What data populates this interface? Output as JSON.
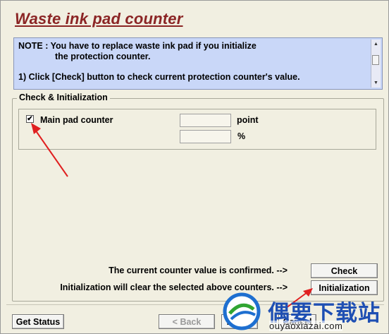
{
  "window": {
    "title": "Waste ink pad counter"
  },
  "note": {
    "line1": "NOTE : You have to replace waste ink pad if you initialize",
    "line2": "the protection counter.",
    "line3": "1) Click [Check] button to check current protection counter's value."
  },
  "group": {
    "label": "Check & Initialization",
    "main_pad": {
      "label": "Main pad counter",
      "checked": true,
      "check_mark": "✔",
      "point_value": "",
      "point_unit": "point",
      "percent_value": "",
      "percent_unit": "%"
    },
    "confirm_text": "The current counter value is confirmed. -->",
    "check_button": "Check",
    "init_text": "Initialization will clear the selected above counters. -->",
    "init_button": "Initialization"
  },
  "footer": {
    "get_status": "Get Status",
    "back": "< Back",
    "finish": "Finish",
    "cancel": "Cancel"
  },
  "watermark": {
    "brand": "偶要下载站",
    "url": "ouyaoxiazai.com",
    "brand_color": "#1e4fb3"
  },
  "colors": {
    "title": "#8b2525",
    "note_bg": "#c9d7f8",
    "panel_bg": "#f1efe1",
    "annotation_arrow": "#e02020"
  }
}
